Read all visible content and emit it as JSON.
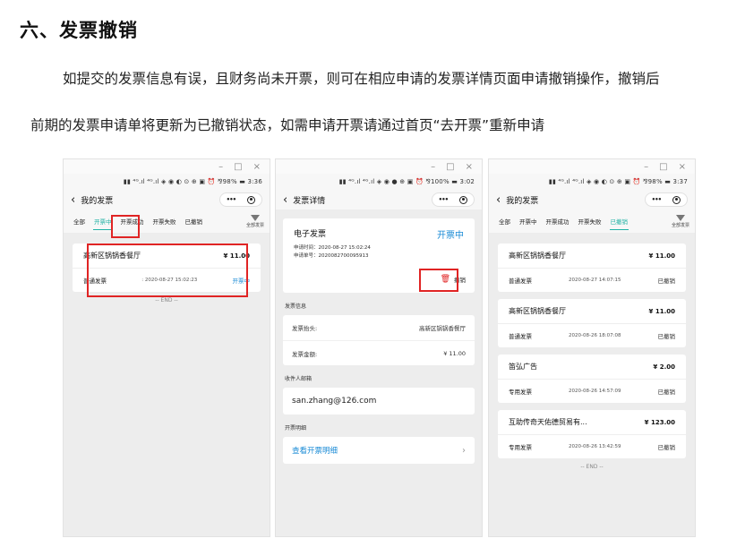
{
  "heading": "六、发票撤销",
  "paragraph1": "如提交的发票信息有误，且财务尚未开票，则可在相应申请的发票详情页面申请撤销操作，撤销后",
  "paragraph2": "前期的发票申请单将更新为已撤销状态，如需申请开票请通过首页“去开票”重新申请",
  "window_controls": {
    "minimize": "–",
    "maximize": "□",
    "close": "×"
  },
  "capsule": {
    "more": "•••"
  },
  "screen1": {
    "status": "▮▮ ⁴ᴳ.ıl ⁴ᴳ.ıl ◈ ◉ ◐ ⊙ ⊕ ▣ ⏰ ⅋98% ▬ 3:36",
    "title": "我的发票",
    "tabs": [
      "全部",
      "开票中",
      "开票成功",
      "开票失败",
      "已撤销"
    ],
    "filter_label": "全部发票",
    "invoices": [
      {
        "name": "高新区锅锅香餐厅",
        "amount": "¥ 11.00",
        "type": "普通发票",
        "date": ": 2020-08-27 15:02:23",
        "status": "开票中"
      }
    ],
    "end": "-- END --"
  },
  "screen2": {
    "status": "▮▮ ⁴ᴳ.ıl ⁴ᴳ.ıl ◈ ◉ ● ⊕ ▣ ⏰ ⅋100% ▬ 3:02",
    "title": "发票详情",
    "einvoice_title": "电子发票",
    "einvoice_status": "开票中",
    "apply_time": "申请时间：2020-08-27 15:02:24",
    "apply_no": "申请单号：2020082700095913",
    "cancel_label": "撤销",
    "section_info": "发票信息",
    "info_rows": [
      {
        "k": "发票抬头:",
        "v": "高新区锅锅香餐厅"
      },
      {
        "k": "发票金额:",
        "v": "¥ 11.00"
      }
    ],
    "section_email": "收件人邮箱",
    "email": "san.zhang@126.com",
    "section_detail": "开票明细",
    "detail_link": "查看开票明细",
    "chevron": "›"
  },
  "screen3": {
    "status": "▮▮ ⁴ᴳ.ıl ⁴ᴳ.ıl ◈ ◉ ◐ ⊙ ⊕ ▣ ⏰ ⅋98% ▬ 3:37",
    "title": "我的发票",
    "tabs": [
      "全部",
      "开票中",
      "开票成功",
      "开票失败",
      "已撤销"
    ],
    "filter_label": "全部发票",
    "invoices": [
      {
        "name": "高新区锅锅香餐厅",
        "amount": "¥ 11.00",
        "type": "普通发票",
        "date": "2020-08-27 14:07:15",
        "status": "已撤销"
      },
      {
        "name": "高新区锅锅香餐厅",
        "amount": "¥ 11.00",
        "type": "普通发票",
        "date": "2020-08-26 18:07:08",
        "status": "已撤销"
      },
      {
        "name": "笛弘广告",
        "amount": "¥ 2.00",
        "type": "专用发票",
        "date": "2020-08-26 14:57:09",
        "status": "已撤销"
      },
      {
        "name": "互助传奇天佑德贸易有...",
        "amount": "¥ 123.00",
        "type": "专用发票",
        "date": "2020-08-26 13:42:59",
        "status": "已撤销"
      }
    ],
    "end": "-- END --"
  },
  "colors": {
    "accent": "#22b2a5",
    "link": "#1a8bd6",
    "highlight": "#e02424"
  }
}
